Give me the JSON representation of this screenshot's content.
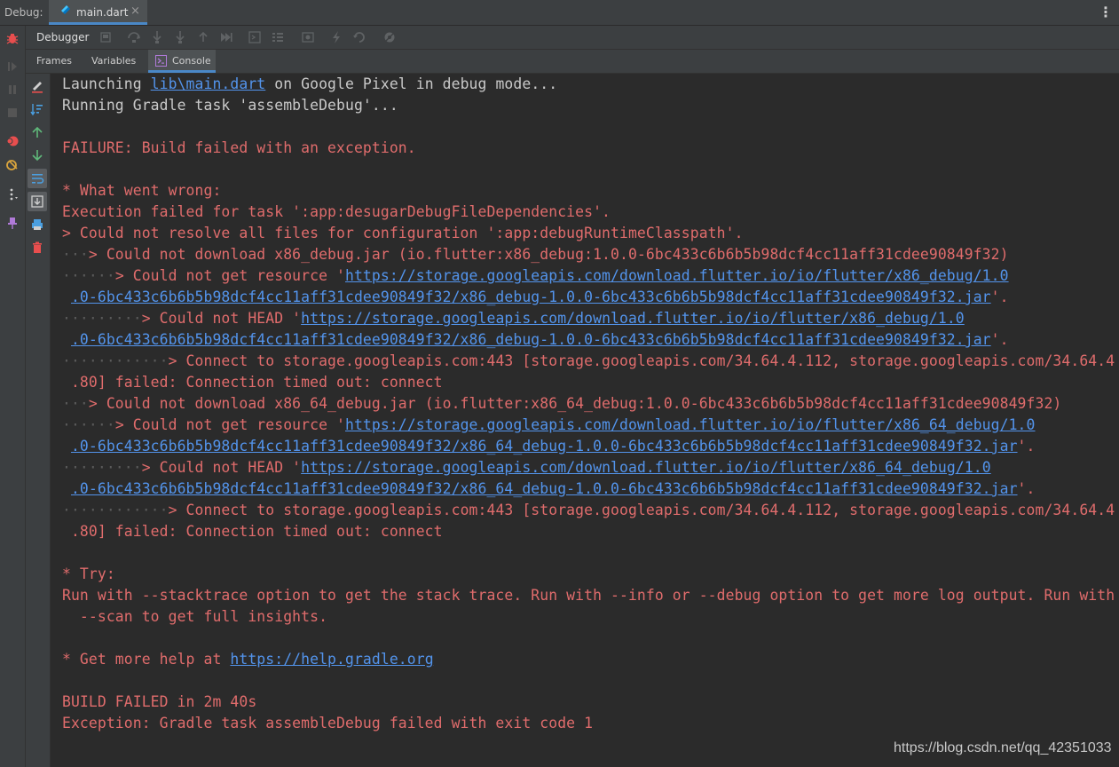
{
  "header": {
    "debug_label": "Debug:",
    "file_tab": {
      "name": "main.dart",
      "close": "×"
    }
  },
  "toolbar": {
    "debugger_label": "Debugger"
  },
  "subtabs": [
    {
      "label": "Frames",
      "active": false
    },
    {
      "label": "Variables",
      "active": false
    },
    {
      "label": "Console",
      "active": true
    }
  ],
  "colors": {
    "accent": "#4a88c7",
    "error": "#e06c6c",
    "link": "#5394ec",
    "background": "#2b2b2b",
    "panel": "#3c3f41"
  },
  "icons": {
    "top": [
      "dart-file-icon",
      "more-options-icon"
    ],
    "rail": [
      "debug-bug-icon",
      "resume-icon",
      "pause-icon",
      "stop-icon",
      "view-breakpoints-icon",
      "mute-breakpoints-icon",
      "more-icon",
      "pin-tab-icon"
    ],
    "toolbar": [
      "restore-layout-icon",
      "step-over-icon",
      "step-into-icon",
      "force-step-into-icon",
      "step-out-icon",
      "run-to-cursor-icon",
      "evaluate-expression-icon",
      "trace-current-stream-icon",
      "camera-icon",
      "flutter-hot-reload-icon",
      "flutter-hot-restart-icon",
      "settings-icon"
    ],
    "console_side": [
      "soft-wrap-edit-icon",
      "sort-icon",
      "up-arrow-icon",
      "down-arrow-icon",
      "wrap-lines-icon",
      "scroll-to-end-icon",
      "print-icon",
      "clear-all-icon"
    ]
  },
  "console": {
    "lines": [
      [
        {
          "t": "Launching ",
          "c": "grey"
        },
        {
          "t": "lib\\main.dart",
          "c": "lnk"
        },
        {
          "t": " on Google Pixel in debug mode...",
          "c": "grey"
        }
      ],
      [
        {
          "t": "Running Gradle task 'assembleDebug'...",
          "c": "grey"
        }
      ],
      [],
      [
        {
          "t": "FAILURE: Build failed with an exception.",
          "c": "red"
        }
      ],
      [],
      [
        {
          "t": "* What went wrong:",
          "c": "red"
        }
      ],
      [
        {
          "t": "Execution failed for task ':app:desugarDebugFileDependencies'.",
          "c": "red"
        }
      ],
      [
        {
          "t": "> Could not resolve all files for configuration ':app:debugRuntimeClasspath'.",
          "c": "red"
        }
      ],
      [
        {
          "t": "···",
          "c": "dots"
        },
        {
          "t": "> Could not download x86_debug.jar (io.flutter:x86_debug:1.0.0-6bc433c6b6b5b98dcf4cc11aff31cdee90849f32)",
          "c": "red"
        }
      ],
      [
        {
          "t": "······",
          "c": "dots"
        },
        {
          "t": "> Could not get resource '",
          "c": "red"
        },
        {
          "t": "https://storage.googleapis.com/download.flutter.io/io/flutter/x86_debug/1.0",
          "c": "lnk"
        }
      ],
      [
        {
          "t": " ",
          "c": "red"
        },
        {
          "t": ".0-6bc433c6b6b5b98dcf4cc11aff31cdee90849f32/x86_debug-1.0.0-6bc433c6b6b5b98dcf4cc11aff31cdee90849f32.jar",
          "c": "lnk"
        },
        {
          "t": "'.",
          "c": "red"
        }
      ],
      [
        {
          "t": "·········",
          "c": "dots"
        },
        {
          "t": "> Could not HEAD '",
          "c": "red"
        },
        {
          "t": "https://storage.googleapis.com/download.flutter.io/io/flutter/x86_debug/1.0",
          "c": "lnk"
        }
      ],
      [
        {
          "t": " ",
          "c": "red"
        },
        {
          "t": ".0-6bc433c6b6b5b98dcf4cc11aff31cdee90849f32/x86_debug-1.0.0-6bc433c6b6b5b98dcf4cc11aff31cdee90849f32.jar",
          "c": "lnk"
        },
        {
          "t": "'.",
          "c": "red"
        }
      ],
      [
        {
          "t": "············",
          "c": "dots"
        },
        {
          "t": "> Connect to storage.googleapis.com:443 [storage.googleapis.com/34.64.4.112, storage.googleapis.com/34.64.4",
          "c": "red"
        }
      ],
      [
        {
          "t": " .80] failed: Connection timed out: connect",
          "c": "red"
        }
      ],
      [
        {
          "t": "···",
          "c": "dots"
        },
        {
          "t": "> Could not download x86_64_debug.jar (io.flutter:x86_64_debug:1.0.0-6bc433c6b6b5b98dcf4cc11aff31cdee90849f32)",
          "c": "red"
        }
      ],
      [
        {
          "t": "······",
          "c": "dots"
        },
        {
          "t": "> Could not get resource '",
          "c": "red"
        },
        {
          "t": "https://storage.googleapis.com/download.flutter.io/io/flutter/x86_64_debug/1.0",
          "c": "lnk"
        }
      ],
      [
        {
          "t": " ",
          "c": "red"
        },
        {
          "t": ".0-6bc433c6b6b5b98dcf4cc11aff31cdee90849f32/x86_64_debug-1.0.0-6bc433c6b6b5b98dcf4cc11aff31cdee90849f32.jar",
          "c": "lnk"
        },
        {
          "t": "'.",
          "c": "red"
        }
      ],
      [
        {
          "t": "·········",
          "c": "dots"
        },
        {
          "t": "> Could not HEAD '",
          "c": "red"
        },
        {
          "t": "https://storage.googleapis.com/download.flutter.io/io/flutter/x86_64_debug/1.0",
          "c": "lnk"
        }
      ],
      [
        {
          "t": " ",
          "c": "red"
        },
        {
          "t": ".0-6bc433c6b6b5b98dcf4cc11aff31cdee90849f32/x86_64_debug-1.0.0-6bc433c6b6b5b98dcf4cc11aff31cdee90849f32.jar",
          "c": "lnk"
        },
        {
          "t": "'.",
          "c": "red"
        }
      ],
      [
        {
          "t": "············",
          "c": "dots"
        },
        {
          "t": "> Connect to storage.googleapis.com:443 [storage.googleapis.com/34.64.4.112, storage.googleapis.com/34.64.4",
          "c": "red"
        }
      ],
      [
        {
          "t": " .80] failed: Connection timed out: connect",
          "c": "red"
        }
      ],
      [],
      [
        {
          "t": "* Try:",
          "c": "red"
        }
      ],
      [
        {
          "t": "Run with --stacktrace option to get the stack trace. Run with --info or --debug option to get more log output. Run with",
          "c": "red"
        }
      ],
      [
        {
          "t": "  --scan to get full insights.",
          "c": "red"
        }
      ],
      [],
      [
        {
          "t": "* Get more help at ",
          "c": "red"
        },
        {
          "t": "https://help.gradle.org",
          "c": "lnk"
        }
      ],
      [],
      [
        {
          "t": "BUILD FAILED in 2m 40s",
          "c": "red"
        }
      ],
      [
        {
          "t": "Exception: Gradle task assembleDebug failed with exit code 1",
          "c": "red"
        }
      ]
    ]
  },
  "watermark": "https://blog.csdn.net/qq_42351033"
}
